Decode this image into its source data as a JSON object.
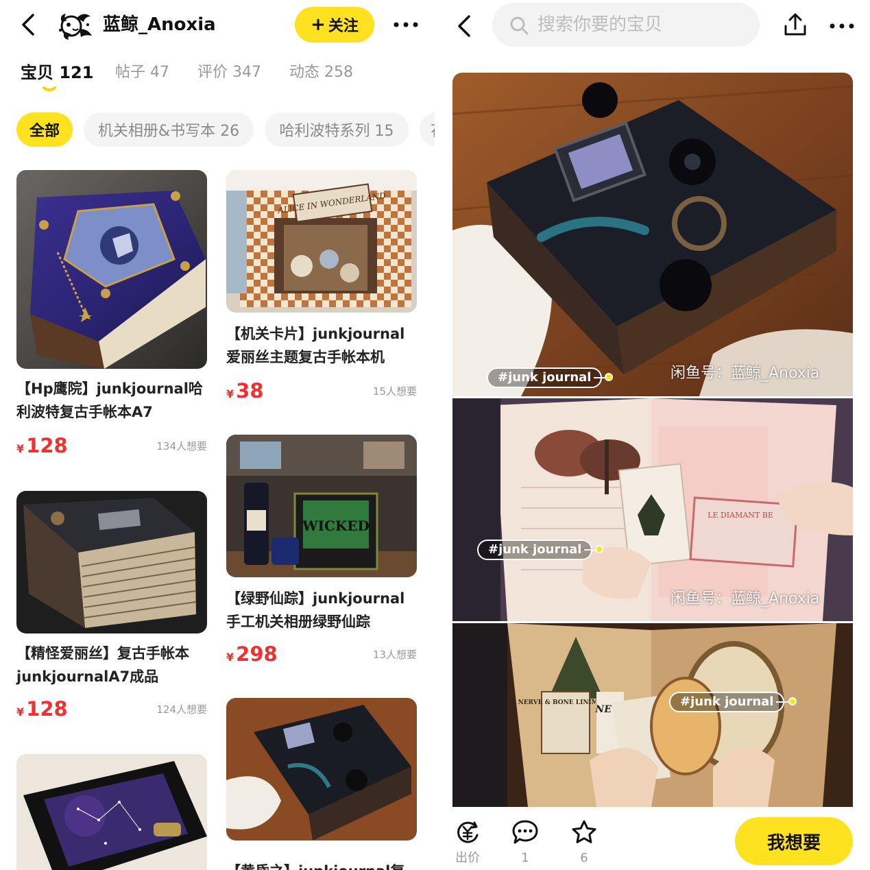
{
  "left": {
    "shop_name": "蓝鲸_Anoxia",
    "follow_label": "关注",
    "follow_plus": "+",
    "tabs": [
      {
        "label": "宝贝 121"
      },
      {
        "label": "帖子 47"
      },
      {
        "label": "评价 347"
      },
      {
        "label": "动态 258"
      }
    ],
    "chips": [
      {
        "label": "全部"
      },
      {
        "label": "机关相册&书写本 26"
      },
      {
        "label": "哈利波特系列 15"
      },
      {
        "label": "花"
      }
    ],
    "items": [
      {
        "title": "【Hp鹰院】junkjournal哈利波特复古手帐本A7",
        "price_symbol": "¥",
        "price": "128",
        "wants": "134人想要"
      },
      {
        "title": "【机关卡片】junkjournal爱丽丝主题复古手帐本机",
        "price_symbol": "¥",
        "price": "38",
        "wants": "15人想要"
      },
      {
        "title": "【精怪爱丽丝】复古手帐本junkjournalA7成品",
        "price_symbol": "¥",
        "price": "128",
        "wants": "124人想要"
      },
      {
        "title": "【绿野仙踪】junkjournal手工机关相册绿野仙踪",
        "price_symbol": "¥",
        "price": "298",
        "wants": "13人想要"
      },
      {
        "title": "",
        "price_symbol": "",
        "price": "",
        "wants": ""
      },
      {
        "title": "【黄昏之】junkjournal复",
        "price_symbol": "",
        "price": "",
        "wants": ""
      }
    ],
    "thumb_texts": {
      "alice_sign": "ALICE IN WONDERLAND",
      "wicked_sign": "WICKED"
    }
  },
  "right": {
    "search_placeholder": "搜索你要的宝贝",
    "tags": [
      {
        "label": "#junk journal"
      },
      {
        "label": "#junk journal"
      },
      {
        "label": "#junk journal"
      }
    ],
    "watermark": "闲鱼号：蓝鲸_Anoxia",
    "photo_texts": {
      "postcard": "LE DIAMANT BE",
      "label_left": "NERVE & BONE LINIMENT",
      "label_news": "NEW"
    },
    "actions": [
      {
        "label": "出价",
        "icon": "bid-yen-icon"
      },
      {
        "label": "1",
        "icon": "comment-bubble-icon"
      },
      {
        "label": "6",
        "icon": "star-icon"
      }
    ],
    "want_label": "我想要"
  },
  "colors": {
    "accent_yellow": "#ffe21f",
    "price_red": "#f23030",
    "muted_gray": "#999999"
  }
}
